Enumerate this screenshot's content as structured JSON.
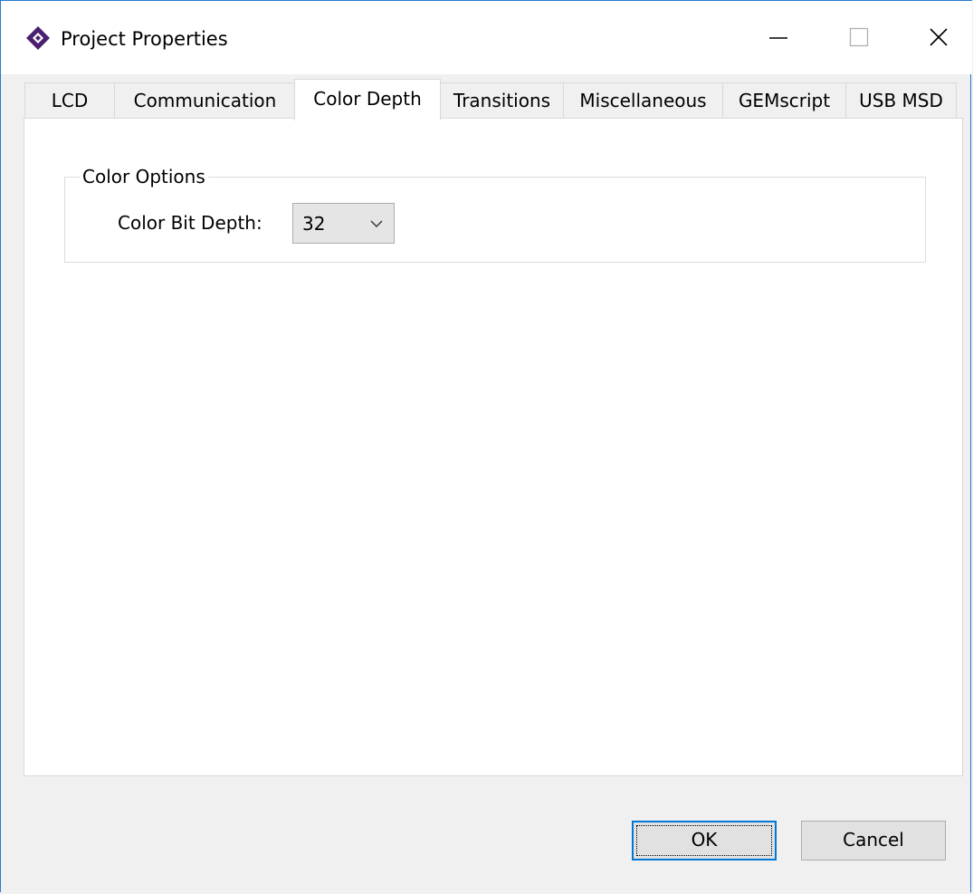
{
  "window": {
    "title": "Project Properties",
    "icons": {
      "app": "diamond-app-icon",
      "minimize": "minimize-icon",
      "maximize": "maximize-icon",
      "close": "close-icon"
    }
  },
  "tabs": [
    {
      "label": "LCD",
      "active": false
    },
    {
      "label": "Communication",
      "active": false
    },
    {
      "label": "Color Depth",
      "active": true
    },
    {
      "label": "Transitions",
      "active": false
    },
    {
      "label": "Miscellaneous",
      "active": false
    },
    {
      "label": "GEMscript",
      "active": false
    },
    {
      "label": "USB MSD",
      "active": false
    }
  ],
  "color_options": {
    "legend": "Color Options",
    "bit_depth_label": "Color Bit Depth:",
    "bit_depth_value": "32"
  },
  "buttons": {
    "ok": "OK",
    "cancel": "Cancel"
  },
  "colors": {
    "window_border": "#2b79d0",
    "focus_border": "#0078d7",
    "icon_purple": "#4b1f6f"
  }
}
